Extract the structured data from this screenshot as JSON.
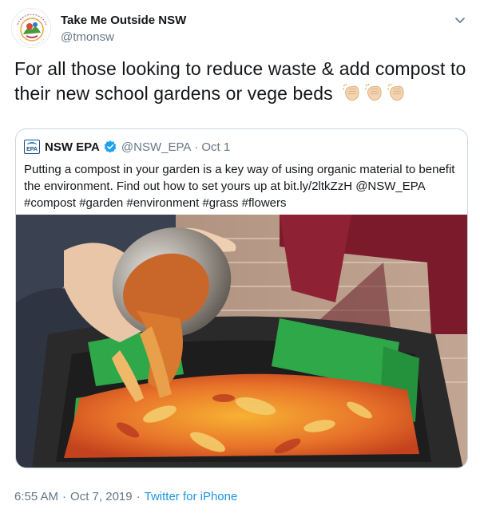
{
  "author": {
    "display_name": "Take Me Outside NSW",
    "handle": "@tmonsw",
    "avatar_text": "TAKE ME OUTSIDE",
    "avatar_subtext": "NEW SOUTH WALES"
  },
  "tweet": {
    "text": "For all those looking to reduce waste & add compost to their new school gardens or vege beds",
    "emoji": [
      "clapping-hands",
      "clapping-hands",
      "clapping-hands"
    ]
  },
  "quote": {
    "logo_text": "EPA",
    "display_name": "NSW EPA",
    "verified": true,
    "handle": "@NSW_EPA",
    "separator": "·",
    "date": "Oct 1",
    "text": "Putting a compost in your garden is a key way of using organic material to benefit the environment. Find out how to set yours up at bit.ly/2ltkZzH @NSW_EPA #compost #garden #environment #grass #flowers"
  },
  "footer": {
    "time": "6:55 AM",
    "separator": "·",
    "date": "Oct 7, 2019",
    "separator2": "·",
    "source": "Twitter for iPhone"
  },
  "colors": {
    "link": "#1b95e0",
    "secondary_text": "#657786",
    "border": "#ccd6dd",
    "verified": "#1da1f2"
  },
  "icons": [
    "chevron-down-icon",
    "verified-badge-icon",
    "clapping-hands-emoji"
  ]
}
